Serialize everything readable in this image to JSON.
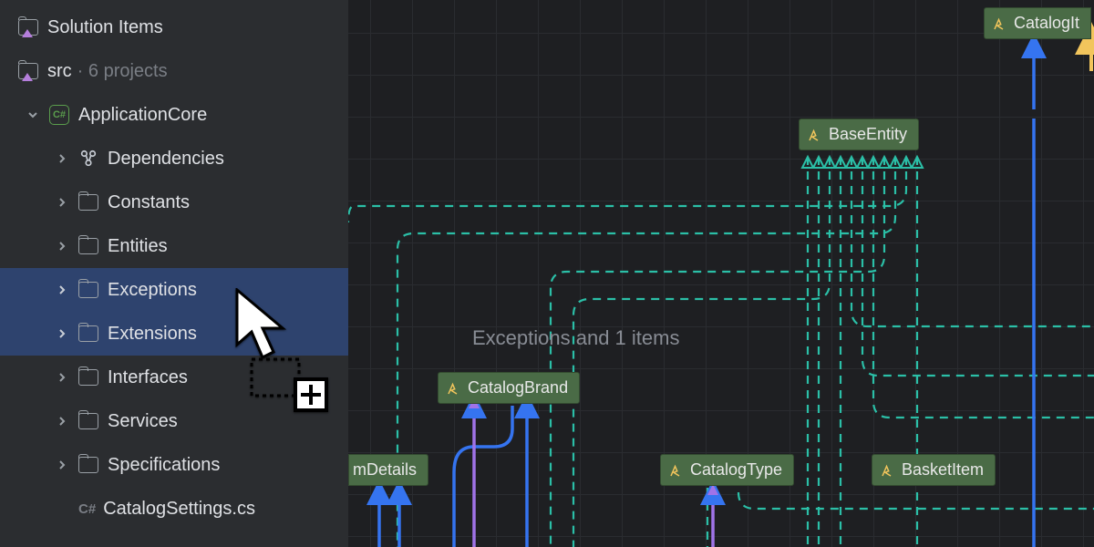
{
  "sidebar": {
    "solution_items": "Solution Items",
    "src": "src",
    "src_hint": "· 6 projects",
    "project": "ApplicationCore",
    "children": [
      {
        "label": "Dependencies"
      },
      {
        "label": "Constants"
      },
      {
        "label": "Entities"
      },
      {
        "label": "Exceptions"
      },
      {
        "label": "Extensions"
      },
      {
        "label": "Interfaces"
      },
      {
        "label": "Services"
      },
      {
        "label": "Specifications"
      }
    ],
    "file": "CatalogSettings.cs"
  },
  "canvas": {
    "drag_label": "Exceptions and 1 items",
    "nodes": {
      "base_entity": "BaseEntity",
      "catalog_brand": "CatalogBrand",
      "catalog_type": "CatalogType",
      "basket_item": "BasketItem",
      "catalog_it": "CatalogIt",
      "m_details": "mDetails"
    }
  }
}
